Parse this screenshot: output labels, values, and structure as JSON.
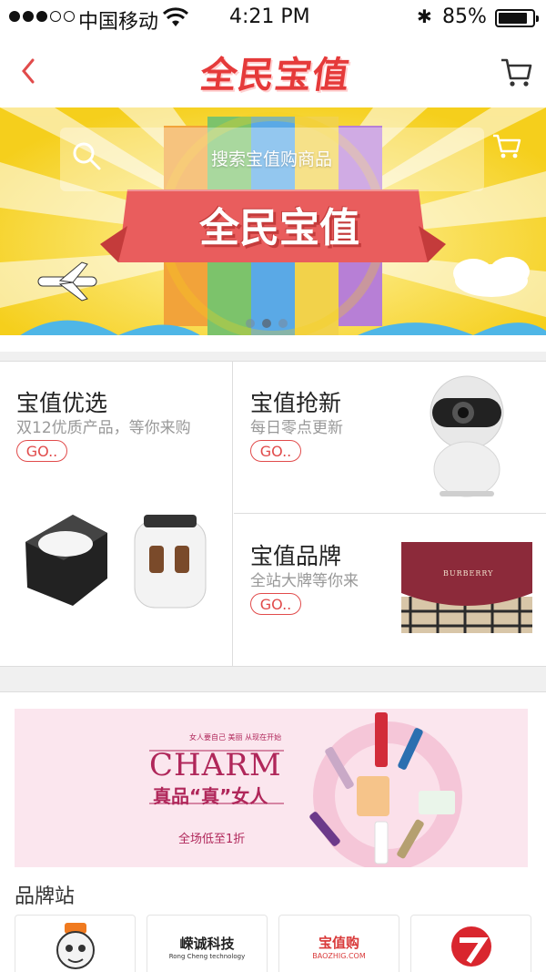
{
  "status_bar": {
    "carrier": "中国移动",
    "time": "4:21 PM",
    "battery": "85%",
    "battery_level": 0.85,
    "signal_filled": 3,
    "signal_total": 5
  },
  "header": {
    "logo_text": "全民宝值",
    "back_icon": "chevron-left-icon",
    "cart_icon": "cart-icon"
  },
  "banner": {
    "search_placeholder": "搜索宝值购商品",
    "title": "全民宝值",
    "page_count": 3,
    "active_page": 1
  },
  "cards": {
    "featured": {
      "title": "宝值优选",
      "subtitle": "双12优质产品，等你来购",
      "cta": "GO.."
    },
    "new": {
      "title": "宝值抢新",
      "subtitle": "每日零点更新",
      "cta": "GO.."
    },
    "brand": {
      "title": "宝值品牌",
      "subtitle": "全站大牌等你来",
      "cta": "GO.."
    },
    "brand_product_label": "BURBERRY"
  },
  "promo": {
    "small_lines": "女人要自己 美丽 从现在开始",
    "headline": "CHARM",
    "tagline": "真品“真”女人",
    "discount": "全场低至1折"
  },
  "brand_station": {
    "title": "品牌站",
    "brands": [
      {
        "name": "brand-mascot"
      },
      {
        "name": "嵘诚科技",
        "sub": "Rong Cheng technology"
      },
      {
        "name": "宝值购",
        "sub": "BAOZHIG.COM"
      },
      {
        "name": "brand-red-logo"
      }
    ]
  },
  "colors": {
    "accent": "#e14b4b",
    "banner_yellow": "#f7d430",
    "charm_pink": "#b0275a"
  }
}
